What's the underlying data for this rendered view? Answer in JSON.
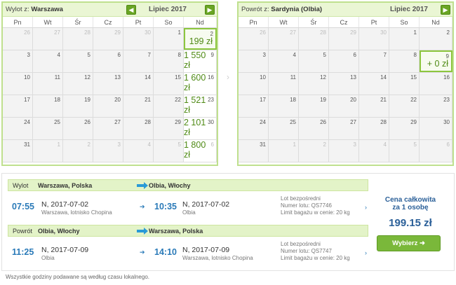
{
  "colors": {
    "accent_green": "#6aa524",
    "price_green": "#4f8a15",
    "time_blue": "#2a7ab8",
    "route_bar": "#e3f3c8"
  },
  "outbound_calendar": {
    "title_prefix": "Wylot z:",
    "city": "Warszawa",
    "month": "Lipiec 2017",
    "prev_icon": "arrow-left-icon",
    "next_icon": "arrow-right-icon",
    "weekdays": [
      "Pn",
      "Wt",
      "Śr",
      "Cz",
      "Pt",
      "So",
      "Nd"
    ],
    "days": [
      "26",
      "27",
      "28",
      "29",
      "30",
      "1",
      "2",
      "3",
      "4",
      "5",
      "6",
      "7",
      "8",
      "9",
      "10",
      "11",
      "12",
      "13",
      "14",
      "15",
      "16",
      "17",
      "18",
      "19",
      "20",
      "21",
      "22",
      "23",
      "24",
      "25",
      "26",
      "27",
      "28",
      "29",
      "30",
      "31",
      "1",
      "2",
      "3",
      "4",
      "5",
      "6"
    ],
    "prices": {
      "6": "199 zł",
      "13": "1 550 zł",
      "20": "1 600 zł",
      "27": "1 521 zł",
      "34": "2 101 zł",
      "41": "1 800 zł"
    }
  },
  "return_calendar": {
    "title_prefix": "Powrót z:",
    "city": "Sardynia (Olbia)",
    "month": "Lipiec 2017",
    "next_icon": "arrow-right-icon",
    "weekdays": [
      "Pn",
      "Wt",
      "Śr",
      "Cz",
      "Pt",
      "So",
      "Nd"
    ],
    "days": [
      "26",
      "27",
      "28",
      "29",
      "30",
      "1",
      "2",
      "3",
      "4",
      "5",
      "6",
      "7",
      "8",
      "9",
      "10",
      "11",
      "12",
      "13",
      "14",
      "15",
      "16",
      "17",
      "18",
      "19",
      "20",
      "21",
      "22",
      "23",
      "24",
      "25",
      "26",
      "27",
      "28",
      "29",
      "30",
      "31",
      "1",
      "2",
      "3",
      "4",
      "5",
      "6"
    ],
    "prices": {
      "13": "+ 0 zł"
    }
  },
  "summary": {
    "outbound": {
      "label": "Wylot",
      "from": "Warszawa, Polska",
      "to": "Olbia, Włochy",
      "dep_time": "07:55",
      "dep_date": "N, 2017-07-02",
      "dep_place": "Warszawa, lotnisko Chopina",
      "arr_time": "10:35",
      "arr_date": "N, 2017-07-02",
      "arr_place": "Olbia",
      "info1": "Lot bezpośredni",
      "info2": "Numer lotu: QS7746",
      "info3": "Limit bagażu w cenie: 20 kg"
    },
    "return": {
      "label": "Powrót",
      "from": "Olbia, Włochy",
      "to": "Warszawa, Polska",
      "dep_time": "11:25",
      "dep_date": "N, 2017-07-09",
      "dep_place": "Olbia",
      "arr_time": "14:10",
      "arr_date": "N, 2017-07-09",
      "arr_place": "Warszawa, lotnisko Chopina",
      "info1": "Lot bezpośredni",
      "info2": "Numer lotu: QS7747",
      "info3": "Limit bagażu w cenie: 20 kg"
    },
    "total_label_1": "Cena całkowita",
    "total_label_2": "za 1 osobę",
    "total_price": "199.15 zł",
    "select_button": "Wybierz",
    "select_icon": "arrow-right-icon"
  },
  "footnote": "Wszystkie godziny podawane są według czasu lokalnego."
}
